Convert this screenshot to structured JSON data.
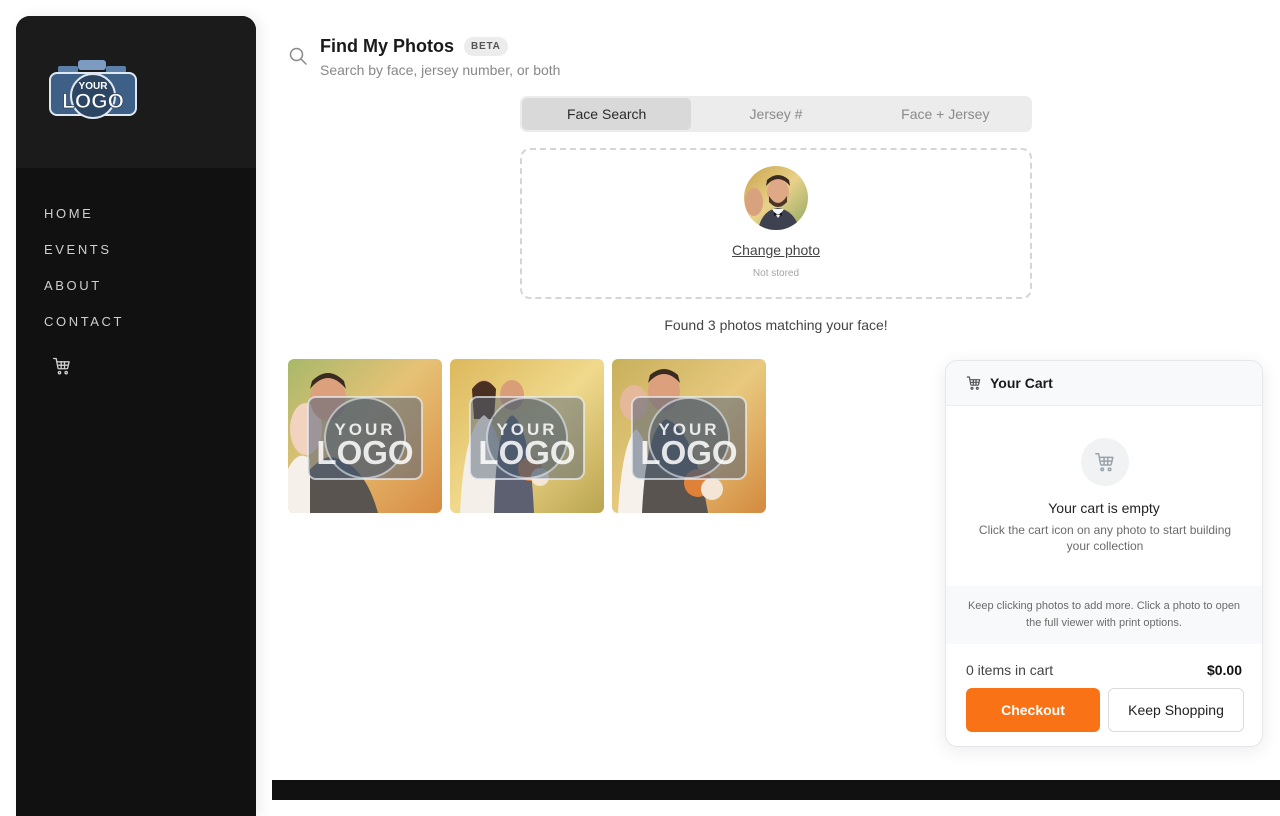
{
  "sidebar": {
    "logo_text_top": "YOUR",
    "logo_text_bottom": "LOGO",
    "nav": [
      {
        "label": "HOME"
      },
      {
        "label": "EVENTS"
      },
      {
        "label": "ABOUT"
      },
      {
        "label": "CONTACT"
      }
    ],
    "cart_icon": "cart-icon"
  },
  "header": {
    "icon": "search-icon",
    "title": "Find My Photos",
    "badge": "BETA",
    "subtitle": "Search by face, jersey number, or both"
  },
  "tabs": [
    {
      "label": "Face Search",
      "active": true
    },
    {
      "label": "Jersey #",
      "active": false
    },
    {
      "label": "Face + Jersey",
      "active": false
    }
  ],
  "upload": {
    "change_label": "Change photo",
    "note": "Not stored"
  },
  "results": {
    "message": "Found 3 photos matching your face!",
    "photos": [
      {
        "watermark_top": "YOUR",
        "watermark_bottom": "LOGO"
      },
      {
        "watermark_top": "YOUR",
        "watermark_bottom": "LOGO"
      },
      {
        "watermark_top": "YOUR",
        "watermark_bottom": "LOGO"
      }
    ]
  },
  "cart": {
    "title": "Your Cart",
    "empty_title": "Your cart is empty",
    "empty_text": "Click the cart icon on any photo to start building your collection",
    "hint": "Keep clicking photos to add more. Click a photo to open the full viewer with print options.",
    "count_text": "0 items in cart",
    "total": "$0.00",
    "checkout_label": "Checkout",
    "keep_label": "Keep Shopping"
  },
  "colors": {
    "accent": "#f97316",
    "sidebar_bg": "#111111"
  }
}
